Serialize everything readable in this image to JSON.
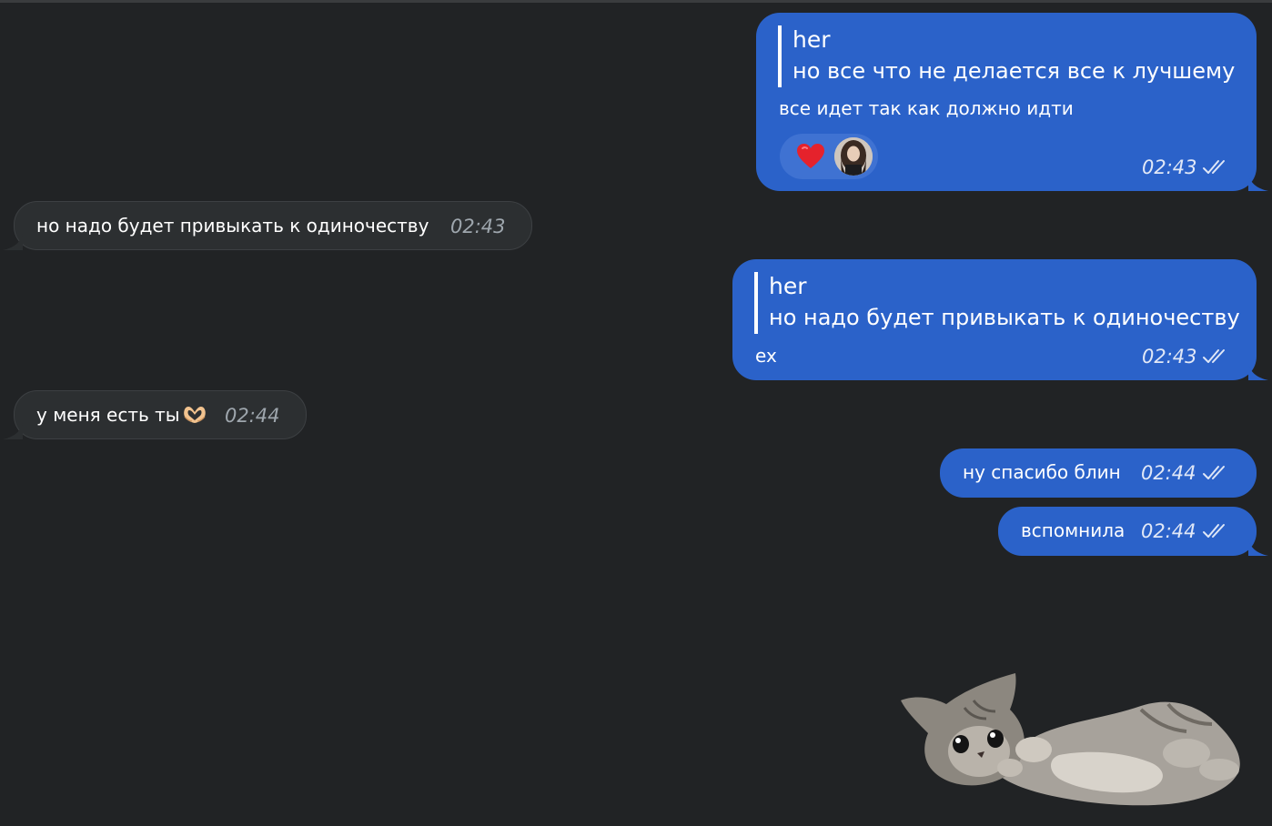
{
  "messages": [
    {
      "direction": "outgoing",
      "reply": {
        "name": "her",
        "text": "но все что не делается все к лучшему"
      },
      "text": "все идет так как должно идти",
      "reactions": [
        "red-heart",
        "avatar"
      ],
      "time": "02:43",
      "status": "read"
    },
    {
      "direction": "incoming",
      "text": "но надо будет привыкать к одиночеству",
      "time": "02:43"
    },
    {
      "direction": "outgoing",
      "reply": {
        "name": "her",
        "text": "но надо будет привыкать к одиночеству"
      },
      "text": "ex",
      "time": "02:43",
      "status": "read"
    },
    {
      "direction": "incoming",
      "text": "у меня есть ты",
      "emoji": "heart-hands-emoji",
      "time": "02:44"
    },
    {
      "direction": "outgoing",
      "text": "ну спасибо блин",
      "time": "02:44",
      "status": "read"
    },
    {
      "direction": "outgoing",
      "text": "вспомнила",
      "time": "02:44",
      "status": "read"
    }
  ],
  "sticker": {
    "icon": "kitten-sticker"
  },
  "colors": {
    "background": "#212325",
    "outgoing_bubble": "#2b62c9",
    "incoming_bubble": "#2c2f31",
    "reaction_pill": "#3f72d2"
  }
}
